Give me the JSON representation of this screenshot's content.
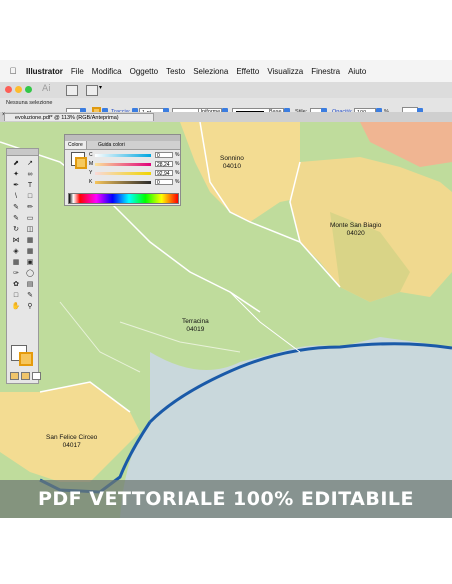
{
  "menubar": {
    "app_name": "Illustrator",
    "items": [
      "File",
      "Modifica",
      "Oggetto",
      "Testo",
      "Seleziona",
      "Effetto",
      "Visualizza",
      "Finestra",
      "Aiuto"
    ]
  },
  "appbar": {
    "logo": "Ai"
  },
  "controlbar": {
    "selection_label": "Nessuna selezione",
    "stroke_label": "Traccia:",
    "stroke_weight": "1 pt",
    "profile_label": "Uniforme",
    "brush_label": "Base",
    "style_label": "Stile:",
    "opacity_label": "Opacità:",
    "opacity_value": "100",
    "opacity_unit": "%"
  },
  "document_tab": {
    "title": "evoluzione.pdf* @ 113% (RGB/Anteprima)",
    "close": "×"
  },
  "color_panel": {
    "tabs": [
      "Colore",
      "Guida colori"
    ],
    "channels": [
      {
        "name": "C",
        "value": "0",
        "unit": "%",
        "bar": "#00a6e0"
      },
      {
        "name": "M",
        "value": "28,24",
        "unit": "%",
        "bar": "#e0007a"
      },
      {
        "name": "Y",
        "value": "92,94",
        "unit": "%",
        "bar": "#f0d400"
      },
      {
        "name": "K",
        "value": "0",
        "unit": "%",
        "bar": "#2a2a2a"
      }
    ]
  },
  "map": {
    "places": [
      {
        "name": "Sonnino",
        "code": "04010"
      },
      {
        "name": "Monte San Biagio",
        "code": "04020"
      },
      {
        "name": "Terracina",
        "code": "04019"
      },
      {
        "name": "San Felice Circeo",
        "code": "04017"
      }
    ],
    "colors": {
      "land": "#bcdc9a",
      "highlight": "#f6df8f",
      "sea": "#c9d9de",
      "coast": "#1a5aa8",
      "roads": "#ffffff"
    }
  },
  "banner": {
    "text": "PDF VETTORIALE 100% EDITABILE"
  }
}
